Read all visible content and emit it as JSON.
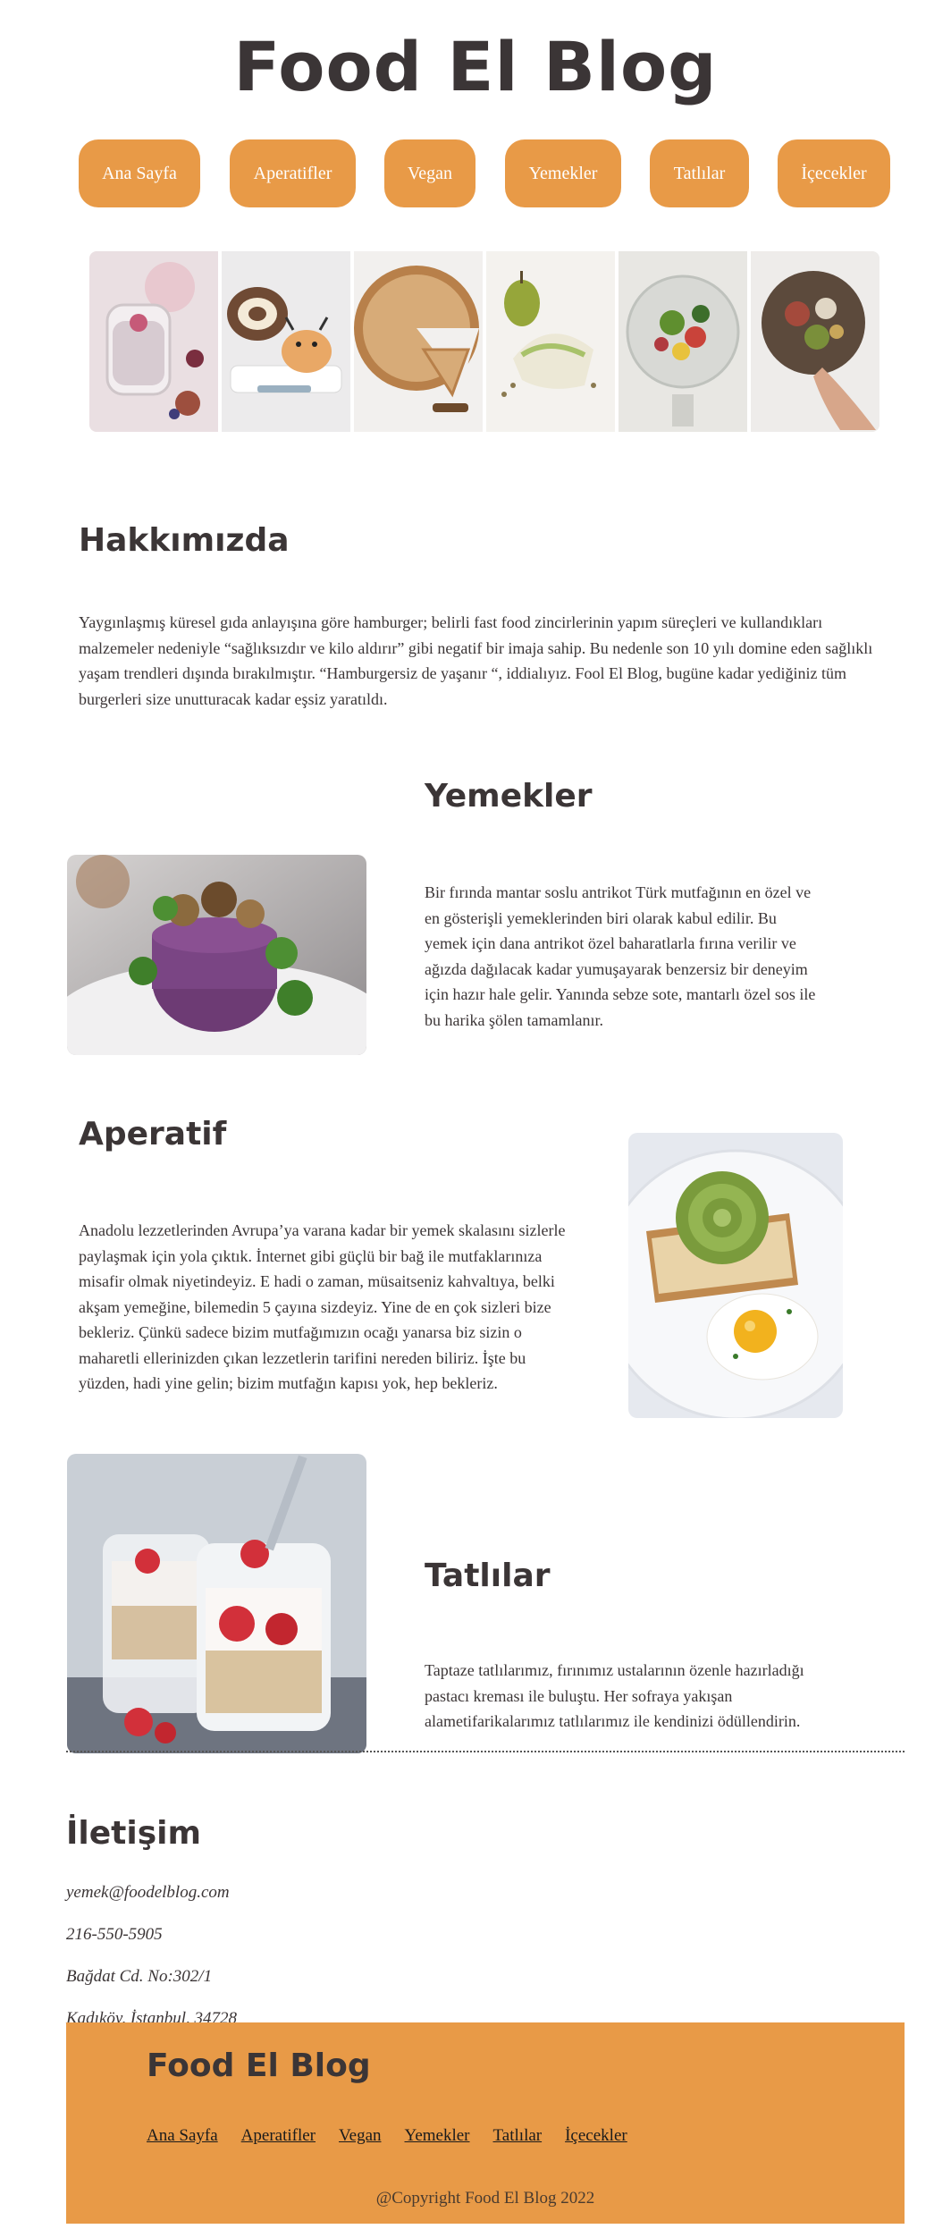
{
  "header": {
    "title": "Food El Blog"
  },
  "nav": {
    "items": [
      {
        "label": "Ana Sayfa"
      },
      {
        "label": "Aperatifler"
      },
      {
        "label": "Vegan"
      },
      {
        "label": "Yemekler"
      },
      {
        "label": "Tatlılar"
      },
      {
        "label": "İçecekler"
      }
    ]
  },
  "gallery": {
    "images": [
      {
        "name": "chia-pudding-jar"
      },
      {
        "name": "cake-roll-and-reindeer-dessert"
      },
      {
        "name": "pie-slice"
      },
      {
        "name": "pear-and-tacos"
      },
      {
        "name": "salad-glass"
      },
      {
        "name": "grain-bowl"
      }
    ]
  },
  "about": {
    "title": "Hakkımızda",
    "text": "Yaygınlaşmış küresel gıda anlayışına göre hamburger; belirli fast food zincirlerinin yapım süreçleri ve kullandıkları malzemeler nedeniyle “sağlıksızdır ve kilo aldırır” gibi negatif bir imaja sahip. Bu nedenle son 10 yılı domine eden sağlıklı yaşam trendleri dışında bırakılmıştır. “Hamburgersiz de yaşanır “, iddialıyız. Fool El Blog, bugüne kadar yediğiniz tüm burgerleri size unutturacak kadar eşsiz yaratıldı."
  },
  "sections": {
    "yemekler": {
      "title": "Yemekler",
      "text": "Bir fırında mantar soslu antrikot Türk mutfağının en özel ve en gösterişli yemeklerinden biri olarak kabul edilir. Bu yemek için dana antrikot özel baharatlarla fırına verilir ve ağızda dağılacak kadar yumuşayarak benzersiz bir deneyim için hazır hale gelir. Yanında sebze sote, mantarlı özel sos ile bu harika şölen tamamlanır."
    },
    "aperatif": {
      "title": "Aperatif",
      "text": "Anadolu lezzetlerinden Avrupa’ya varana kadar bir yemek skalasını sizlerle paylaşmak için yola çıktık. İnternet gibi güçlü bir bağ ile mutfaklarınıza misafir olmak niyetindeyiz. E hadi o zaman, müsaitseniz kahvaltıya, belki akşam yemeğine, bilemedin 5 çayına sizdeyiz. Yine de en çok sizleri bize bekleriz. Çünkü sadece bizim mutfağımızın ocağı yanarsa biz sizin o maharetli ellerinizden çıkan lezzetlerin tarifini nereden biliriz. İşte bu yüzden, hadi yine gelin; bizim mutfağın kapısı yok, hep bekleriz."
    },
    "tatlilar": {
      "title": "Tatlılar",
      "text": "Taptaze tatlılarımız, fırınımız ustalarının özenle hazırladığı pastacı kreması ile buluştu. Her sofraya yakışan alametifarikalarımız tatlılarımız ile kendinizi ödüllendirin."
    }
  },
  "contact": {
    "title": "İletişim",
    "email": "yemek@foodelblog.com",
    "phone": "216-550-5905",
    "address1": "Bağdat Cd. No:302/1",
    "address2": "Kadıköy, İstanbul, 34728"
  },
  "footer": {
    "title": "Food El Blog",
    "links": [
      {
        "label": "Ana Sayfa"
      },
      {
        "label": "Aperatifler"
      },
      {
        "label": "Vegan"
      },
      {
        "label": "Yemekler"
      },
      {
        "label": "Tatlılar"
      },
      {
        "label": "İçecekler"
      }
    ],
    "copyright": "@Copyright Food El Blog 2022"
  },
  "colors": {
    "accent": "#e89a47",
    "text": "#3b3536",
    "background": "#ffffff"
  }
}
